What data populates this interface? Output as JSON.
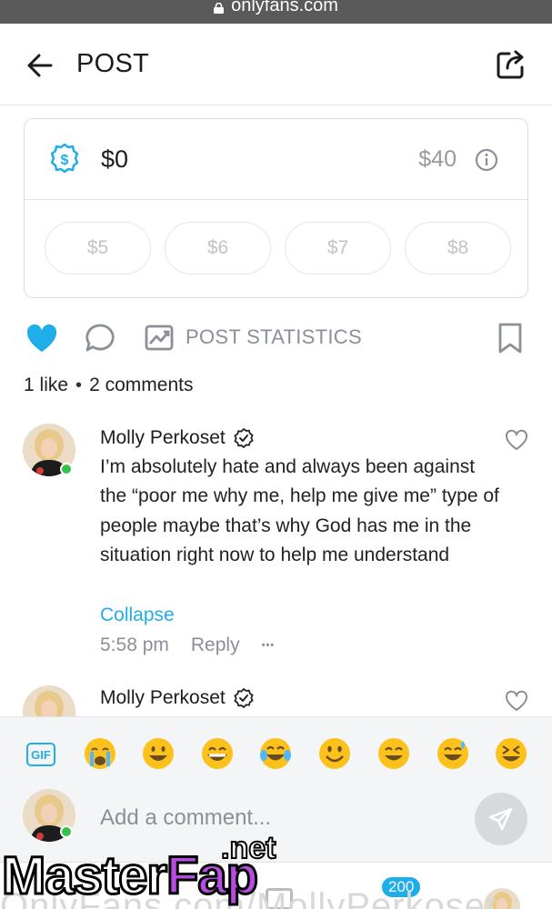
{
  "browser": {
    "url": "onlyfans.com"
  },
  "header": {
    "title": "POST"
  },
  "tip": {
    "value": "$0",
    "max": "$40",
    "presets": [
      "$5",
      "$6",
      "$7",
      "$8"
    ]
  },
  "actions": {
    "stats_label": "POST STATISTICS",
    "like_color": "#1faee9"
  },
  "counts": {
    "likes_num": "1",
    "likes_label": "like",
    "separator": "•",
    "comments_num": "2",
    "comments_label": "comments"
  },
  "comments": [
    {
      "author": "Molly Perkoset",
      "verified": true,
      "text": "I’m absolutely hate and always been against the “poor me why me, help me give me” type of people maybe that’s why God has me in the situation right now to help me understand",
      "collapse_label": "Collapse",
      "time": "5:58 pm",
      "reply_label": "Reply",
      "more_label": "•••"
    },
    {
      "author": "Molly Perkoset",
      "verified": true
    }
  ],
  "emoji_bar": {
    "gif_label": "GIF",
    "emojis": [
      "loudly-crying-face",
      "grinning-face",
      "beaming-face",
      "tears-of-joy-face",
      "smiling-face",
      "grinning-smiling-eyes-face",
      "sweat-smile-face",
      "squinting-face"
    ]
  },
  "composer": {
    "placeholder": "Add a comment..."
  },
  "bottom_nav": {
    "badge": "200"
  },
  "watermark": {
    "main_a": "Master",
    "main_b": "Fap",
    "suffix": ".net",
    "ghost_text": "OnlyFans.com/MollyPerkoset"
  }
}
